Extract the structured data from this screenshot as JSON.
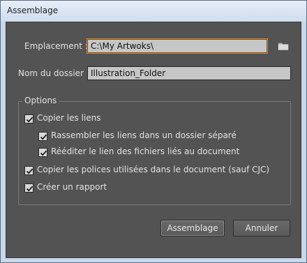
{
  "window": {
    "title": "Assemblage"
  },
  "location": {
    "label": "Emplacement :",
    "value": "C:\\My Artwoks\\"
  },
  "folder_name": {
    "label": "Nom du dossier :",
    "value": "Illustration_Folder"
  },
  "options": {
    "legend": "Options",
    "copy_links": {
      "label": "Copier les liens",
      "checked": true
    },
    "collect_links": {
      "label": "Rassembler les liens dans un dossier séparé",
      "checked": true
    },
    "relink_files": {
      "label": "Rééditer le lien des fichiers liés au document",
      "checked": true
    },
    "copy_fonts": {
      "label": "Copier les polices utilisées dans le document (sauf CJC)",
      "checked": true
    },
    "create_report": {
      "label": "Créer un rapport",
      "checked": true
    }
  },
  "buttons": {
    "package": "Assemblage",
    "cancel": "Annuler"
  },
  "icons": {
    "browse": "folder-icon",
    "check": "checkmark-icon"
  },
  "colors": {
    "panel": "#535353",
    "focus": "#d98a2f",
    "field": "#c6c6c6"
  }
}
